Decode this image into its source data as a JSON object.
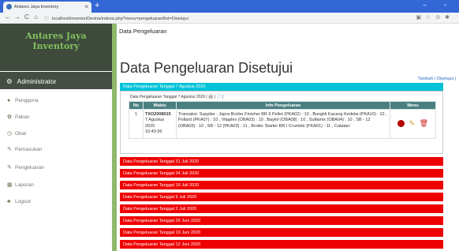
{
  "browser": {
    "tab_title": "Antares Jaya Inventory",
    "url": "localhost/inventoriDevina/indexa.php?menu=pengeluaranBot=Disetujui"
  },
  "sidebar": {
    "brand_line1": "Antares Jaya",
    "brand_line2": "Inventory",
    "admin_label": "Administrator",
    "items": [
      {
        "label": "Pengguna",
        "icon": "user-icon"
      },
      {
        "label": "Pakan",
        "icon": "gear-icon"
      },
      {
        "label": "Obat",
        "icon": "clock-icon"
      },
      {
        "label": "Pemasukan",
        "icon": "pencil-icon"
      },
      {
        "label": "Pengeluaran",
        "icon": "pencil-icon"
      },
      {
        "label": "Laporan",
        "icon": "grid-icon"
      },
      {
        "label": "Logout",
        "icon": "people-icon"
      }
    ]
  },
  "main": {
    "breadcrumb": "Data Pengeluaran",
    "title": "Data Pengeluaran Disetujui",
    "top_link": "Tambah | Disetujui |",
    "active_date_header": "Data Pengeluaran Tanggal 7 Agustus 2020",
    "table_subtitle": "Data Pengeluaran Tanggal 7 Agustus 2020 | 🖨 | 📄 |",
    "table": {
      "headers": [
        "No",
        "Waktu",
        "Info Pengeluaran",
        "Menu"
      ],
      "rows": [
        {
          "no": "1",
          "kode": "TXO2008015",
          "tanggal": "7 Agustus 2020",
          "jam": "10:49:36",
          "info": "Transaksi: Supplier : Japra Broiler Finisher BR II Pellet (PKA02) : 10 , Bungkil Kacang Kedelai (PKA10) : 10 , Pollard (PKA07) : 10 , Vitaplex (OBA03) : 10 , Baytril (OBA08) : 10 , Sulfamix (OBA04) : 10 , SB - 12 (OBA03) : 10 , SB - 12 (PKA03) : 11 , Broiler Starter BR I Crumble (PKA01) : 11 , Catatan:"
        }
      ]
    },
    "other_dates": [
      "Data Pengeluaran Tanggal 31 Juli 2020",
      "Data Pengeluaran Tanggal 24 Juli 2020",
      "Data Pengeluaran Tanggal 16 Juli 2020",
      "Data Pengeluaran Tanggal 9 Juli 2020",
      "Data Pengeluaran Tanggal 2 Juli 2020",
      "Data Pengeluaran Tanggal 26 Juni 2020",
      "Data Pengeluaran Tanggal 19 Juni 2020",
      "Data Pengeluaran Tanggal 12 Juni 2020"
    ]
  }
}
